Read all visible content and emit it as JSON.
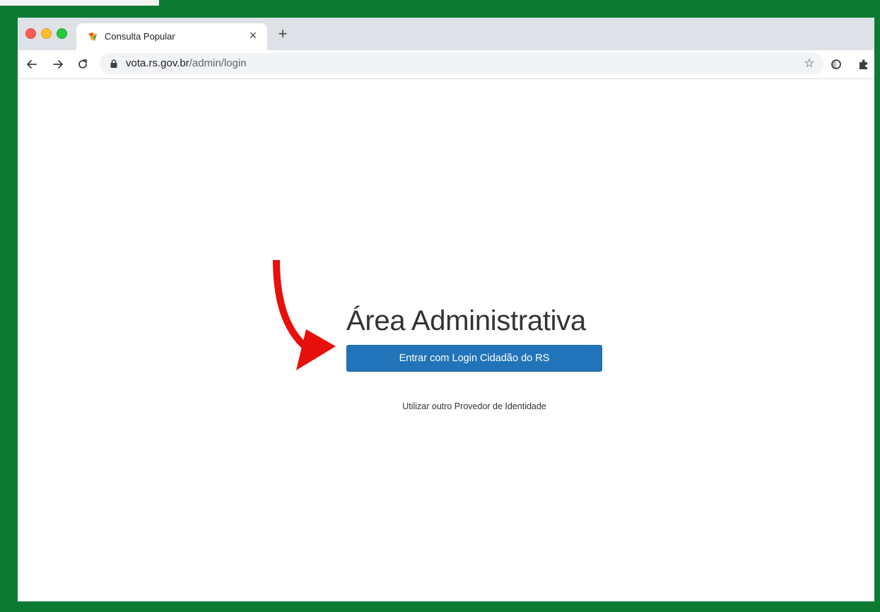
{
  "browser": {
    "tab": {
      "title": "Consulta Popular",
      "close_glyph": "×",
      "favicon": "consulta-popular-favicon"
    },
    "new_tab_glyph": "+",
    "address": {
      "host": "vota.rs.gov.br",
      "path": "/admin/login"
    },
    "star_glyph": "☆",
    "icons": [
      "back-icon",
      "forward-icon",
      "reload-icon",
      "lock-icon",
      "star-icon",
      "extension-icon",
      "puzzle-icon"
    ]
  },
  "page": {
    "heading": "Área Administrativa",
    "login_button_label": "Entrar com Login Cidadão do RS",
    "alt_provider_label": "Utilizar outro Provedor de Identidade"
  },
  "colors": {
    "frame_green": "#0b7b34",
    "button_blue": "#2174b9",
    "annotation_red": "#e8100d"
  }
}
